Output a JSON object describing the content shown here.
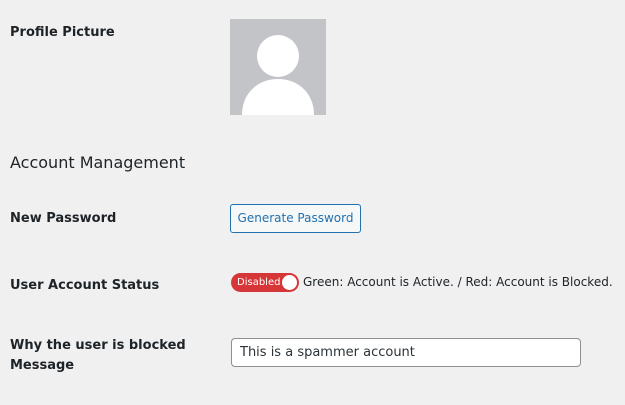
{
  "profile": {
    "picture_label": "Profile Picture"
  },
  "account_management": {
    "heading": "Account Management",
    "new_password_label": "New Password",
    "generate_password_button": "Generate Password",
    "status_label": "User Account Status",
    "status_toggle_text": "Disabled",
    "status_toggle_color": "#d63638",
    "status_note": "Green: Account is Active. / Red: Account is Blocked.",
    "block_reason_label_line1": "Why the user is blocked",
    "block_reason_label_line2": "Message",
    "block_reason_value": "This is a spammer account"
  },
  "icons": {
    "avatar": "default-user-silhouette-icon"
  },
  "colors": {
    "background": "#f0f0f1",
    "accent": "#2271b1",
    "avatar_bg": "#c3c4c7",
    "blocked": "#d63638"
  }
}
